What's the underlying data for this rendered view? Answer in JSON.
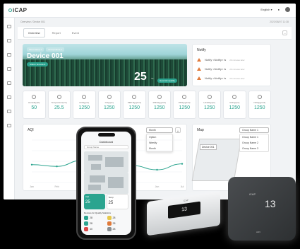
{
  "topbar": {
    "brand": "iCAP",
    "language": "English",
    "language_arrow": "▾"
  },
  "breadcrumb": "Overview / Device 001",
  "date": "2023/08/07 11:38",
  "tabs": [
    {
      "label": "Overview"
    },
    {
      "label": "Report"
    },
    {
      "label": "Event"
    }
  ],
  "more_label": "...",
  "hero": {
    "chips": [
      "Floor Name 1",
      "Group Name 1"
    ],
    "title": "Device 001",
    "badge": "Status: Excellent",
    "reading": "25",
    "reading_unit": "°C",
    "reading_badge": "Good Air Quality"
  },
  "notify": {
    "title": "Notify",
    "rows": [
      {
        "text": "Notify <Notify> is",
        "time": "20 minutes later"
      },
      {
        "text": "Notify <Notify> is",
        "time": "20 minutes later"
      },
      {
        "text": "Notify <Notify> is",
        "time": "20 minutes later"
      }
    ]
  },
  "metrics": [
    {
      "label": "Humidity(%)",
      "value": "50"
    },
    {
      "label": "Temperature(°C)",
      "value": "25.5"
    },
    {
      "label": "CO2(ppm)",
      "value": "1250"
    },
    {
      "label": "CO(ppm)",
      "value": "1250"
    },
    {
      "label": "PM2.5(µg/m3)",
      "value": "1250"
    },
    {
      "label": "PM10(µg/m3)",
      "value": "1250"
    },
    {
      "label": "PM1(µg/m3)",
      "value": "1250"
    },
    {
      "label": "HCHO(ppm)",
      "value": "1250"
    },
    {
      "label": "VOC(ppm)",
      "value": "1250"
    },
    {
      "label": "NO2(µg/m3)",
      "value": "1250"
    }
  ],
  "aqi": {
    "title": "AQI",
    "select_value": "Month",
    "download_icon": "download-icon",
    "options": [
      "Option",
      "Weekly",
      "Month"
    ],
    "x_labels": [
      "Jan",
      "Feb",
      "Mar",
      "Apr",
      "May",
      "Jun",
      "Jul"
    ]
  },
  "map": {
    "title": "Map",
    "select_value": "Group Name 1",
    "options": [
      "Group Name 1",
      "Group Name 2",
      "Group Name 3"
    ],
    "device_tag": "Device 001"
  },
  "phone": {
    "title": "Dashboard",
    "search": "Group Name",
    "tiles": [
      {
        "label": "AQI",
        "value": "25"
      },
      {
        "label": "Temp",
        "value": "25"
      }
    ],
    "list_title": "Devices Air Quality Statistics",
    "list": [
      {
        "value": "28",
        "color": "#2ba48f"
      },
      {
        "value": "28",
        "color": "#e6c84a"
      },
      {
        "value": "28",
        "color": "#2ba48f"
      },
      {
        "value": "28",
        "color": "#e07a3a"
      },
      {
        "value": "40",
        "color": "#d94848"
      },
      {
        "value": "28",
        "color": "#8a8f92"
      }
    ]
  },
  "device1": {
    "display": "13",
    "logo": "iCAP"
  },
  "device2": {
    "display": "13",
    "logo": "iCAP",
    "caption": "ADV"
  },
  "chart_data": {
    "type": "line",
    "x": [
      "Jan",
      "Feb",
      "Mar",
      "Apr",
      "May",
      "Jun",
      "Jul"
    ],
    "series": [
      {
        "values": [
          42,
          38,
          52,
          66,
          40,
          30,
          44
        ]
      }
    ],
    "ylim": [
      0,
      100
    ],
    "color": "#2ba48f"
  }
}
